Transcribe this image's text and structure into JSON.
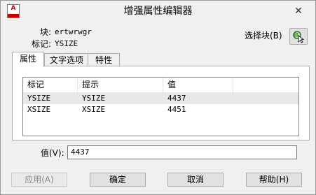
{
  "window": {
    "title": "增强属性编辑器",
    "close_symbol": "✕",
    "app_icon_letter": "A"
  },
  "block": {
    "block_label": "块:",
    "block_name": "ertwrwgr",
    "tag_label": "标记:",
    "tag_name": "YSIZE"
  },
  "select_block": {
    "label": "选择块(B)",
    "icon": "select-objects-icon"
  },
  "tabs": [
    {
      "label": "属性",
      "active": true
    },
    {
      "label": "文字选项",
      "active": false
    },
    {
      "label": "特性",
      "active": false
    }
  ],
  "attributes_table": {
    "headers": [
      "标记",
      "提示",
      "值"
    ],
    "rows": [
      {
        "tag": "YSIZE",
        "prompt": "YSIZE",
        "value": "4437",
        "selected": true
      },
      {
        "tag": "XSIZE",
        "prompt": "XSIZE",
        "value": "4451",
        "selected": false
      }
    ]
  },
  "value_field": {
    "label": "值(V):",
    "value": "4437"
  },
  "buttons": {
    "apply": "应用(A)",
    "ok": "确定",
    "cancel": "取消",
    "help": "帮助(H)"
  },
  "colors": {
    "background": "#f0f0f0",
    "icon_red": "#cc0000",
    "selected_row": "#e8e8e8"
  }
}
